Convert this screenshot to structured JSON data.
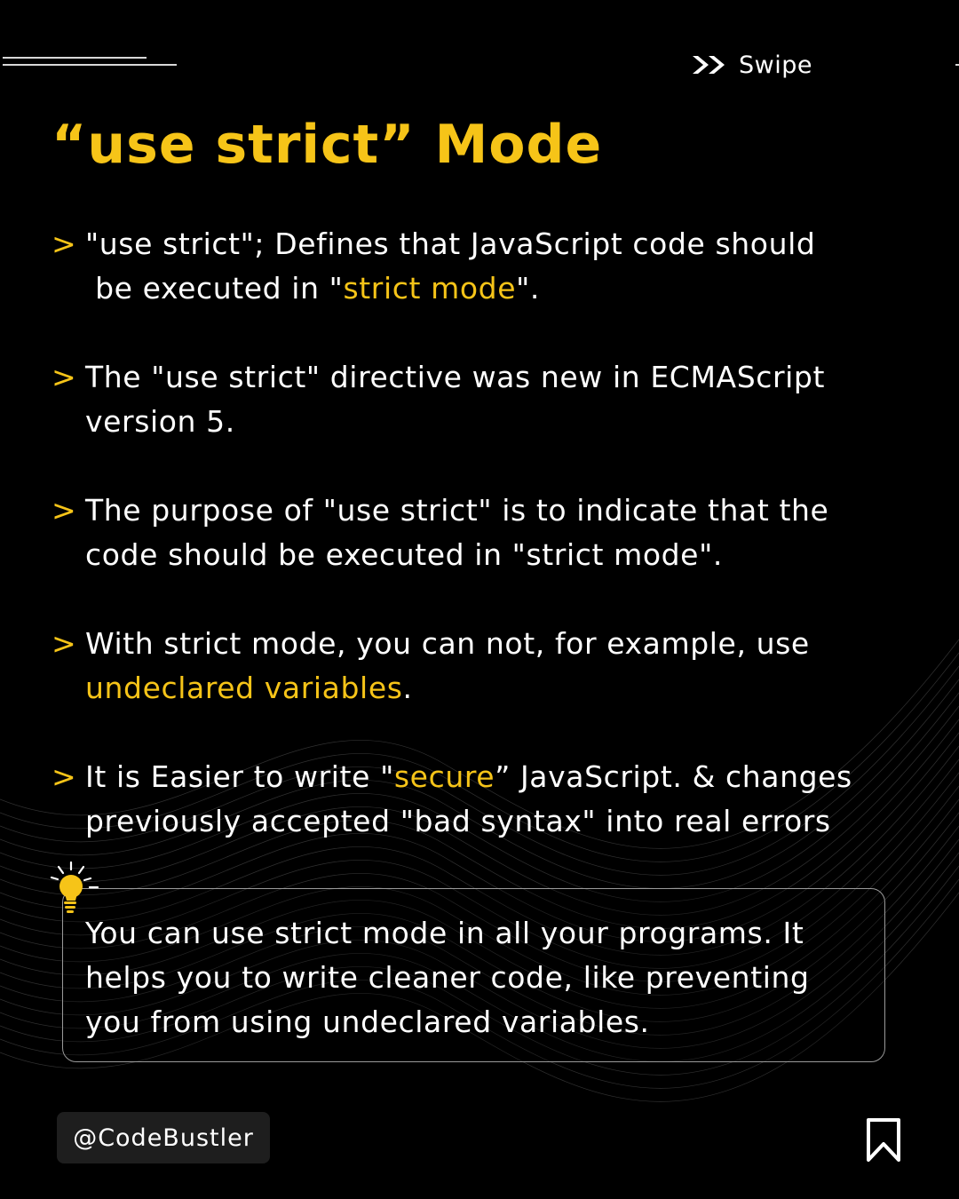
{
  "header": {
    "swipe_label": "Swipe",
    "swipe_icon": "double-chevron-right-icon"
  },
  "title": "“use strict” Mode",
  "bullets": [
    {
      "arrow": ">",
      "line1": "\"use strict\"; Defines that JavaScript code should",
      "line2_pre": " be executed in \"",
      "line2_highlight": "strict mode",
      "line2_post": "\"."
    },
    {
      "arrow": ">",
      "line1": "The \"use strict\" directive was new in ECMAScript",
      "line2": "version 5."
    },
    {
      "arrow": ">",
      "line1": "The purpose of \"use strict\" is to indicate that the",
      "line2": "code should be executed in \"strict mode\"."
    },
    {
      "arrow": ">",
      "line1": "With strict mode, you can not, for example, use",
      "line2_highlight": "undeclared variables",
      "line2_post": "."
    },
    {
      "arrow": ">",
      "line1_pre": "It is Easier to write \"",
      "line1_highlight": "secure",
      "line1_post": "” JavaScript. & changes",
      "line2": "previously accepted \"bad syntax\" into real errors"
    }
  ],
  "tip": {
    "icon": "lightbulb-icon",
    "lines": [
      "You can use strict mode in all your programs. It",
      "helps you to write cleaner code, like preventing",
      "you from using undeclared variables."
    ]
  },
  "footer": {
    "handle": "@CodeBustler",
    "bookmark_icon": "bookmark-icon"
  },
  "colors": {
    "background": "#000000",
    "accent": "#f6c418",
    "text": "#ffffff"
  }
}
